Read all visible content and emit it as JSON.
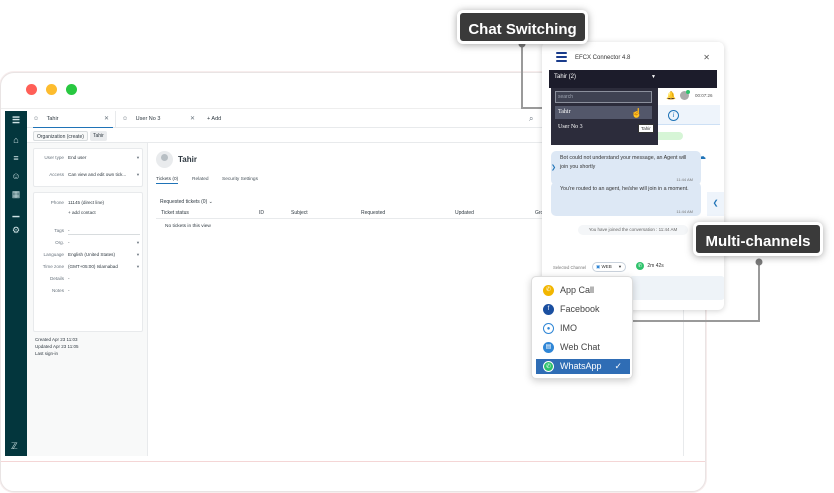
{
  "browser": {
    "controls": [
      "close",
      "minimize",
      "maximize"
    ]
  },
  "zendesk": {
    "tabs": [
      {
        "label": "Tahir"
      },
      {
        "label": "User No 3"
      }
    ],
    "add_tab_label": "+ Add",
    "breadcrumbs": [
      "Organization (create)",
      "Tahir"
    ],
    "user_fields": [
      {
        "label": "User type",
        "value": "End user"
      },
      {
        "label": "Access",
        "value": "Can view and edit own tick..."
      }
    ],
    "phone": {
      "label": "Phone",
      "value": "11145 (direct line)",
      "add_contact": "+ add contact"
    },
    "details_fields": [
      {
        "label": "Tags",
        "value": "-"
      },
      {
        "label": "Org.",
        "value": "-"
      },
      {
        "label": "Language",
        "value": "English (United States)"
      },
      {
        "label": "Time zone",
        "value": "(GMT+05:00) Islamabad"
      },
      {
        "label": "Details",
        "value": "-"
      },
      {
        "label": "Notes",
        "value": "-"
      }
    ],
    "meta": {
      "created": "Created  Apr 23 11:03",
      "updated": "Updated  Apr 23 11:05",
      "last_signin": "Last sign-in"
    },
    "user_name": "Tahir",
    "subtabs": [
      "Tickets (0)",
      "Related",
      "Security Settings"
    ],
    "requested_title": "Requested tickets (0)",
    "table_headers": [
      "Ticket status",
      "ID",
      "Subject",
      "Requested",
      "Updated",
      "Group"
    ],
    "empty_text": "No tickets in this view"
  },
  "widget": {
    "title": "EFCX Connector 4.8",
    "current_user": "Tahir (2)",
    "search_placeholder": "search",
    "dropdown_items": [
      "Tahir",
      "User No 3"
    ],
    "tooltip": "Tahir",
    "timer": "00:07:26",
    "messages": [
      {
        "text": "Bot could not understand your message, an Agent will join you shortly",
        "time": "11:44 AM"
      },
      {
        "text": "You're routed to an agent, he/she will join in a moment.",
        "time": "11:44 AM"
      }
    ],
    "joined_notice": "You have joined the conversation  : 11:44 AM",
    "selected_channel_label": "Selected Channel",
    "selected_channel": "WEB",
    "whatsapp_timer": "2m 42s"
  },
  "channel_menu": {
    "items": [
      {
        "label": "App Call",
        "icon": "app-call-icon"
      },
      {
        "label": "Facebook",
        "icon": "facebook-icon"
      },
      {
        "label": "IMO",
        "icon": "imo-icon"
      },
      {
        "label": "Web Chat",
        "icon": "web-chat-icon"
      },
      {
        "label": "WhatsApp",
        "icon": "whatsapp-icon",
        "selected": true
      }
    ]
  },
  "callouts": {
    "chat_switching": "Chat Switching",
    "multi_channels": "Multi-channels"
  },
  "colors": {
    "rail": "#03363d",
    "widget_header": "#1c1c2b",
    "selected_channel_bg": "#2f6db5",
    "callout_bg": "#3a3a3a"
  }
}
